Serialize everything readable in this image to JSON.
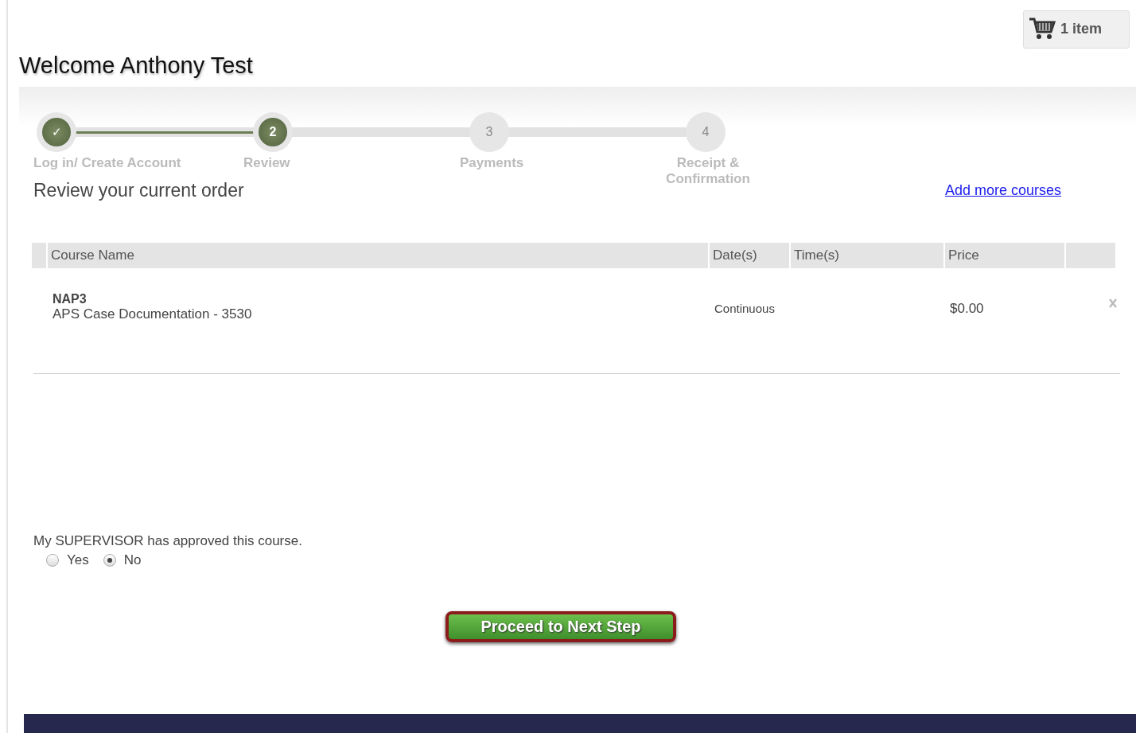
{
  "cart": {
    "label": "1 item"
  },
  "welcome": "Welcome Anthony Test",
  "steps": [
    {
      "mark": "✓",
      "label": "Log in/ Create Account",
      "completed": true,
      "selected": false
    },
    {
      "mark": "2",
      "label": "Review",
      "completed": false,
      "selected": true
    },
    {
      "mark": "3",
      "label": "Payments",
      "completed": false,
      "selected": false
    },
    {
      "mark": "4",
      "label": "Receipt & Confirmation",
      "completed": false,
      "selected": false
    }
  ],
  "heading": "Review your current order",
  "add_link": "Add more courses",
  "table": {
    "columns": [
      "Course Name",
      "Date(s)",
      "Time(s)",
      "Price"
    ],
    "rows": [
      {
        "code": "NAP3",
        "name": "APS Case Documentation - 3530",
        "dates": "Continuous",
        "price": "$0.00"
      }
    ]
  },
  "approval": {
    "question": "My SUPERVISOR has approved this course.",
    "options": [
      {
        "label": "Yes",
        "selected": false
      },
      {
        "label": "No",
        "selected": true
      }
    ]
  },
  "proceed_button": "Proceed to Next Step"
}
